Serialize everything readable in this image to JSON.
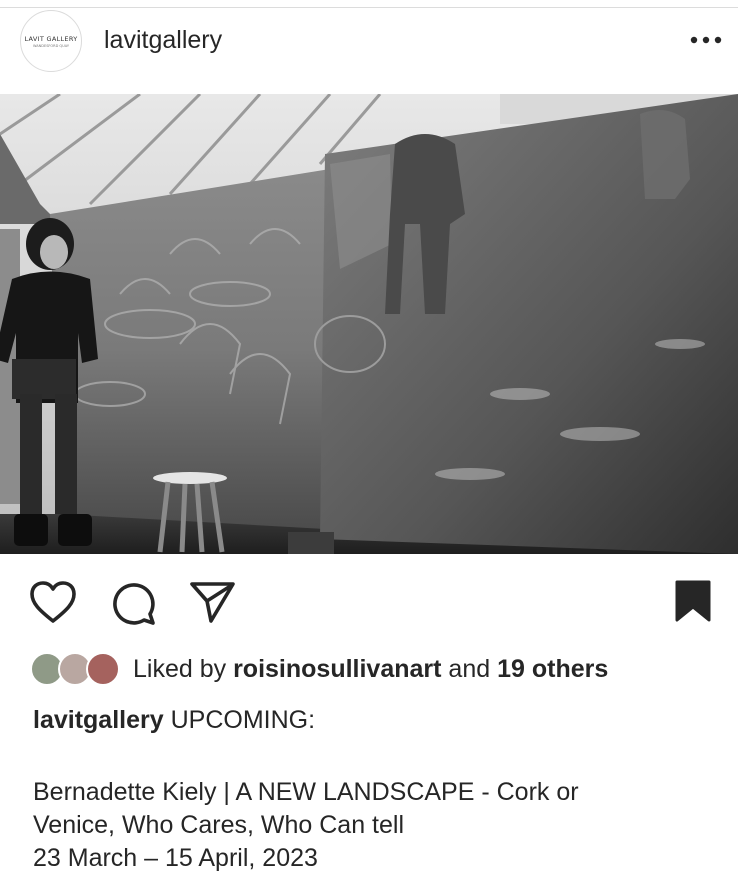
{
  "post": {
    "account": {
      "username": "lavitgallery",
      "avatar_line1": "LAVIT GALLERY",
      "avatar_line2": "WANDESFORD QUAY"
    },
    "menu_icon": "more-horizontal-icon",
    "photo_description_icon": "photo",
    "actions": {
      "like_icon": "heart-outline-icon",
      "comment_icon": "comment-bubble-icon",
      "share_icon": "paper-plane-icon",
      "save_icon": "bookmark-filled-icon"
    },
    "likes": {
      "prefix": "Liked by",
      "liker": "roisinosullivanart",
      "connector": "and",
      "others": "19 others"
    },
    "caption": {
      "username": "lavitgallery",
      "headline": "UPCOMING:",
      "line1": "Bernadette Kiely | A NEW LANDSCAPE - Cork or",
      "line2": "Venice, Who Cares, Who Can tell",
      "line3": "23 March – 15 April, 2023"
    },
    "colors": {
      "text": "#262626",
      "background": "#ffffff",
      "icon": "#262626"
    }
  }
}
